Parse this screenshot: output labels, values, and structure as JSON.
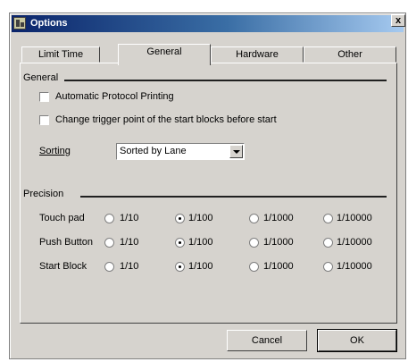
{
  "window": {
    "title": "Options",
    "close_label": "x"
  },
  "tabs": [
    {
      "label": "Limit Time",
      "active": false
    },
    {
      "label": "General",
      "active": true
    },
    {
      "label": "Hardware",
      "active": false
    },
    {
      "label": "Other",
      "active": false
    }
  ],
  "general": {
    "group_title": "General",
    "auto_print_label": "Automatic Protocol Printing",
    "auto_print_checked": false,
    "change_trigger_label": "Change trigger point of the start blocks before start",
    "change_trigger_checked": false,
    "sorting_label": "Sorting",
    "sorting_value": "Sorted by Lane"
  },
  "precision": {
    "group_title": "Precision",
    "options": [
      "1/10",
      "1/100",
      "1/1000",
      "1/10000"
    ],
    "rows": [
      {
        "label": "Touch pad",
        "selected": "1/100"
      },
      {
        "label": "Push Button",
        "selected": "1/100"
      },
      {
        "label": "Start Block",
        "selected": "1/100"
      }
    ]
  },
  "buttons": {
    "cancel": "Cancel",
    "ok": "OK"
  },
  "colors": {
    "face": "#d6d3ce",
    "title_start": "#0a246a",
    "title_end": "#a6caf0"
  }
}
